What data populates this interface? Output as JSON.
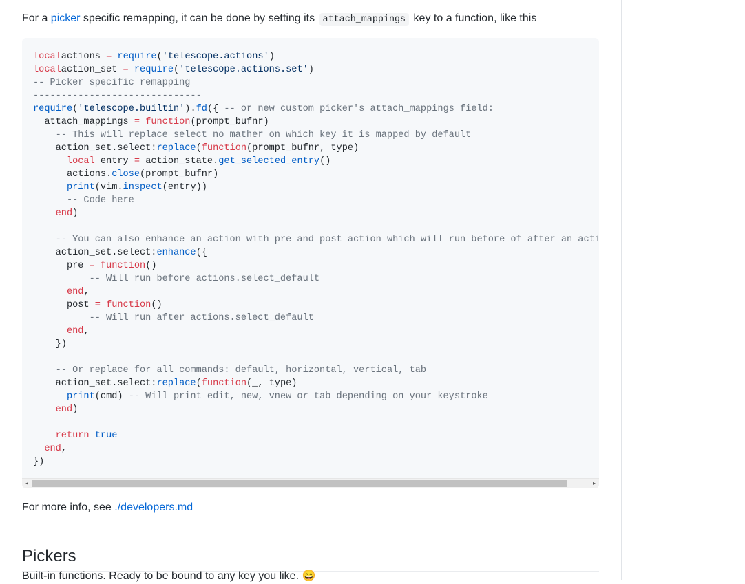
{
  "intro": {
    "prefix": "For a ",
    "link": "picker",
    "middle": " specific remapping, it can be done by setting its ",
    "code": "attach_mappings",
    "suffix": " key to a function, like this"
  },
  "code_lines": [
    [
      [
        "kw",
        "local"
      ],
      [
        "",
        "actions "
      ],
      [
        "kw",
        "="
      ],
      [
        "",
        " "
      ],
      [
        "fn",
        "require"
      ],
      [
        "",
        "("
      ],
      [
        "str",
        "'telescope.actions'"
      ],
      [
        "",
        ")"
      ]
    ],
    [
      [
        "kw",
        "local"
      ],
      [
        "",
        "action_set "
      ],
      [
        "kw",
        "="
      ],
      [
        "",
        " "
      ],
      [
        "fn",
        "require"
      ],
      [
        "",
        "("
      ],
      [
        "str",
        "'telescope.actions.set'"
      ],
      [
        "",
        ")"
      ]
    ],
    [
      [
        "cm",
        "-- Picker specific remapping"
      ]
    ],
    [
      [
        "cm",
        "------------------------------"
      ]
    ],
    [
      [
        "fn",
        "require"
      ],
      [
        "",
        "("
      ],
      [
        "str",
        "'telescope.builtin'"
      ],
      [
        "",
        ")."
      ],
      [
        "fn",
        "fd"
      ],
      [
        "",
        "({ "
      ],
      [
        "cm",
        "-- or new custom picker's attach_mappings field:"
      ]
    ],
    [
      [
        "",
        "  attach_mappings "
      ],
      [
        "kw",
        "="
      ],
      [
        "",
        " "
      ],
      [
        "kw",
        "function"
      ],
      [
        "",
        "(prompt_bufnr)"
      ]
    ],
    [
      [
        "",
        "    "
      ],
      [
        "cm",
        "-- This will replace select no mather on which key it is mapped by default"
      ]
    ],
    [
      [
        "",
        "    action_set.select:"
      ],
      [
        "fn",
        "replace"
      ],
      [
        "",
        "("
      ],
      [
        "kw",
        "function"
      ],
      [
        "",
        "(prompt_bufnr, type)"
      ]
    ],
    [
      [
        "",
        "      "
      ],
      [
        "kw",
        "local"
      ],
      [
        "",
        " entry "
      ],
      [
        "kw",
        "="
      ],
      [
        "",
        " action_state."
      ],
      [
        "fn",
        "get_selected_entry"
      ],
      [
        "",
        "()"
      ]
    ],
    [
      [
        "",
        "      actions."
      ],
      [
        "fn",
        "close"
      ],
      [
        "",
        "(prompt_bufnr)"
      ]
    ],
    [
      [
        "",
        "      "
      ],
      [
        "fn",
        "print"
      ],
      [
        "",
        "(vim."
      ],
      [
        "fn",
        "inspect"
      ],
      [
        "",
        "(entry))"
      ]
    ],
    [
      [
        "",
        "      "
      ],
      [
        "cm",
        "-- Code here"
      ]
    ],
    [
      [
        "",
        "    "
      ],
      [
        "kw",
        "end"
      ],
      [
        "",
        ")"
      ]
    ],
    [
      [
        "",
        ""
      ]
    ],
    [
      [
        "",
        "    "
      ],
      [
        "cm",
        "-- You can also enhance an action with pre and post action which will run before of after an action"
      ]
    ],
    [
      [
        "",
        "    action_set.select:"
      ],
      [
        "fn",
        "enhance"
      ],
      [
        "",
        "({"
      ]
    ],
    [
      [
        "",
        "      pre "
      ],
      [
        "kw",
        "="
      ],
      [
        "",
        " "
      ],
      [
        "kw",
        "function"
      ],
      [
        "",
        "()"
      ]
    ],
    [
      [
        "",
        "          "
      ],
      [
        "cm",
        "-- Will run before actions.select_default"
      ]
    ],
    [
      [
        "",
        "      "
      ],
      [
        "kw",
        "end"
      ],
      [
        "",
        ","
      ]
    ],
    [
      [
        "",
        "      post "
      ],
      [
        "kw",
        "="
      ],
      [
        "",
        " "
      ],
      [
        "kw",
        "function"
      ],
      [
        "",
        "()"
      ]
    ],
    [
      [
        "",
        "          "
      ],
      [
        "cm",
        "-- Will run after actions.select_default"
      ]
    ],
    [
      [
        "",
        "      "
      ],
      [
        "kw",
        "end"
      ],
      [
        "",
        ","
      ]
    ],
    [
      [
        "",
        "    })"
      ]
    ],
    [
      [
        "",
        ""
      ]
    ],
    [
      [
        "",
        "    "
      ],
      [
        "cm",
        "-- Or replace for all commands: default, horizontal, vertical, tab"
      ]
    ],
    [
      [
        "",
        "    action_set.select:"
      ],
      [
        "fn",
        "replace"
      ],
      [
        "",
        "("
      ],
      [
        "kw",
        "function"
      ],
      [
        "",
        "(_, type)"
      ]
    ],
    [
      [
        "",
        "      "
      ],
      [
        "fn",
        "print"
      ],
      [
        "",
        "(cmd) "
      ],
      [
        "cm",
        "-- Will print edit, new, vnew or tab depending on your keystroke"
      ]
    ],
    [
      [
        "",
        "    "
      ],
      [
        "kw",
        "end"
      ],
      [
        "",
        ")"
      ]
    ],
    [
      [
        "",
        ""
      ]
    ],
    [
      [
        "",
        "    "
      ],
      [
        "kw",
        "return"
      ],
      [
        "",
        " "
      ],
      [
        "fn",
        "true"
      ]
    ],
    [
      [
        "",
        "  "
      ],
      [
        "kw",
        "end"
      ],
      [
        "",
        ","
      ]
    ],
    [
      [
        "",
        "})"
      ]
    ]
  ],
  "more_info": {
    "prefix": "For more info, see ",
    "link": "./developers.md"
  },
  "heading": "Pickers",
  "description": "Built-in functions. Ready to be bound to any key you like. 😄",
  "icons": {
    "scroll_left": "◂",
    "scroll_right": "▸"
  }
}
